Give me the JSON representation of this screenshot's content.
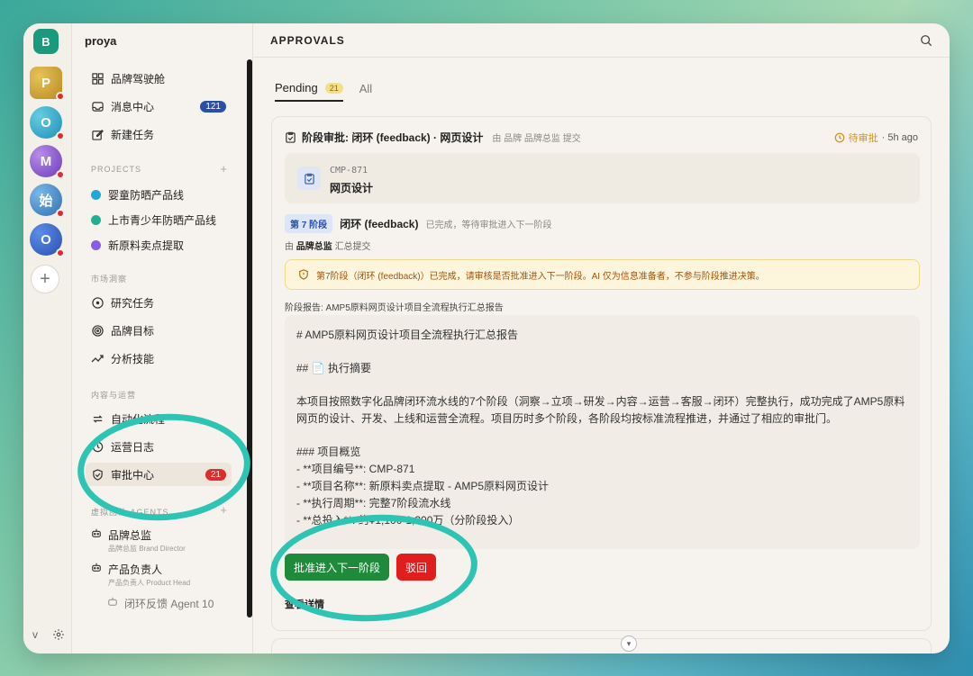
{
  "workspaces": {
    "current": "B",
    "items": [
      {
        "letter": "P"
      },
      {
        "letter": "O"
      },
      {
        "letter": "M"
      },
      {
        "letter": "始"
      },
      {
        "letter": "O"
      }
    ],
    "add": "+"
  },
  "rail_bottom": {
    "version": "v"
  },
  "sidebar": {
    "title": "proya",
    "top_items": [
      {
        "label": "品牌驾驶舱"
      },
      {
        "label": "消息中心",
        "badge": "121"
      },
      {
        "label": "新建任务"
      }
    ],
    "projects_label": "PROJECTS",
    "projects": [
      {
        "label": "婴童防晒产品线",
        "color": "#1fa8d8"
      },
      {
        "label": "上市青少年防晒产品线",
        "color": "#1fb090"
      },
      {
        "label": "新原料卖点提取",
        "color": "#8a5ae8"
      }
    ],
    "market_label": "市场洞察",
    "market_items": [
      {
        "label": "研究任务"
      },
      {
        "label": "品牌目标"
      },
      {
        "label": "分析技能"
      }
    ],
    "ops_label": "内容与运营",
    "ops_items": [
      {
        "label": "自动化流程"
      },
      {
        "label": "运营日志"
      },
      {
        "label": "审批中心",
        "badge": "21"
      }
    ],
    "agents_label": "虚拟团队 AGENTS",
    "agents": [
      {
        "name": "品牌总监",
        "sub": "品牌总监 Brand Director"
      },
      {
        "name": "产品负责人",
        "sub": "产品负责人 Product Head"
      },
      {
        "name": "闭环反馈 Agent 10"
      }
    ]
  },
  "header": {
    "title": "APPROVALS"
  },
  "tabs": [
    {
      "label": "Pending",
      "count": "21"
    },
    {
      "label": "All"
    }
  ],
  "card": {
    "title": "阶段审批: 闭环 (feedback) · 网页设计",
    "by": "由 品牌  品牌总监 提交",
    "status": "待审批",
    "time": "· 5h ago",
    "project_code": "CMP-871",
    "project_name": "网页设计",
    "stage_badge": "第 7 阶段",
    "stage_name": "闭环 (feedback)",
    "stage_note": "已完成，等待审批进入下一阶段",
    "submitter_prefix": "由",
    "submitter_name": "品牌总监",
    "submitter_suffix": "汇总提交",
    "warning": "第7阶段（闭环 (feedback)）已完成，请审核是否批准进入下一阶段。AI 仅为信息准备者，不参与阶段推进决策。",
    "report_label": "阶段报告: AMP5原料网页设计项目全流程执行汇总报告",
    "report_lines": {
      "h1": "# AMP5原料网页设计项目全流程执行汇总报告",
      "h2": "## 📄 执行摘要",
      "summary": "本项目按照数字化品牌闭环流水线的7个阶段（洞察→立项→研发→内容→运营→客服→闭环）完整执行，成功完成了AMP5原料网页的设计、开发、上线和运营全流程。项目历时多个阶段，各阶段均按标准流程推进，并通过了相应的审批门。",
      "h3": "### 项目概览",
      "li1": "- **项目编号**: CMP-871",
      "li2": "- **项目名称**: 新原料卖点提取 - AMP5原料网页设计",
      "li3": "- **执行周期**: 完整7阶段流水线",
      "li4": "- **总投入**: 约¥1,100-1,300万（分阶段投入）"
    },
    "approve_label": "批准进入下一阶段",
    "reject_label": "驳回",
    "detail_label": "查看详情"
  }
}
